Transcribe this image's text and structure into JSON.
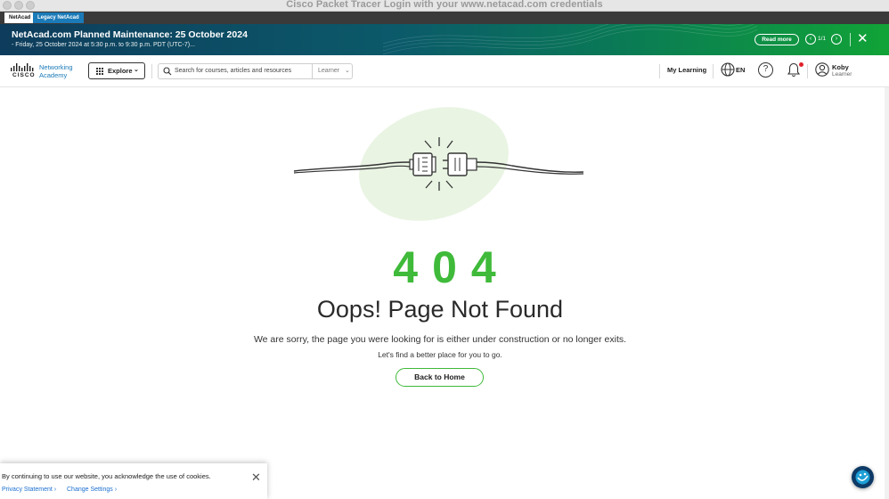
{
  "window": {
    "title": "Cisco Packet Tracer Login with your www.netacad.com credentials"
  },
  "tabs": [
    {
      "label": "NetAcad"
    },
    {
      "label": "Legacy NetAcad"
    }
  ],
  "banner": {
    "title": "NetAcad.com Planned Maintenance: 25 October 2024",
    "subtitle": "- Friday, 25 October 2024 at 5:30 p.m. to 9:30 p.m. PDT (UTC-7)...",
    "read_more": "Read more",
    "pager": "1/1",
    "prev_glyph": "‹",
    "next_glyph": "›",
    "close_glyph": "✕"
  },
  "header": {
    "logo_cisco": "CISCO",
    "logo_line1": "Networking",
    "logo_line2": "Academy",
    "explore": "Explore",
    "search_placeholder": "Search for courses, articles and resources",
    "role": "Learner",
    "my_learning": "My Learning",
    "language": "EN",
    "help_glyph": "?",
    "user_name": "Koby",
    "user_role": "Learner",
    "colors": {
      "brand_blue": "#1b7ab8",
      "notification": "#e0202a"
    }
  },
  "main": {
    "code": "404",
    "heading": "Oops! Page Not Found",
    "message": "We are sorry, the page you were looking for is either under construction or no longer exits.",
    "sub_message": "Let's find a better place for you to go.",
    "back_button": "Back to Home",
    "accent": "#3fba3a"
  },
  "cookie": {
    "message": "By continuing to use our website, you acknowledge the use of cookies.",
    "privacy": "Privacy Statement ›",
    "settings": "Change Settings ›",
    "close_glyph": "✕"
  }
}
